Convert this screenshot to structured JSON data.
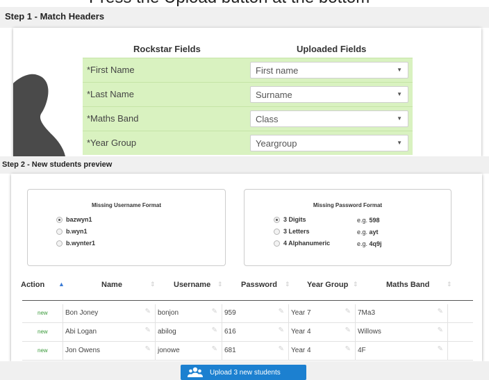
{
  "banner": {
    "text": "Press the Upload button at the bottom"
  },
  "step1": {
    "title": "Step 1 - Match Headers",
    "rockstar_header": "Rockstar Fields",
    "uploaded_header": "Uploaded Fields",
    "rows": [
      {
        "field": "*First Name",
        "value": "First name"
      },
      {
        "field": "*Last Name",
        "value": "Surname"
      },
      {
        "field": "*Maths Band",
        "value": "Class"
      },
      {
        "field": "*Year Group",
        "value": "Yeargroup"
      }
    ],
    "row_color": "#d9f2c0"
  },
  "step2": {
    "title": "Step 2 - New students preview",
    "username_format": {
      "title": "Missing Username Format",
      "options": [
        "bazwyn1",
        "b.wyn1",
        "b.wynter1"
      ],
      "selected": "bazwyn1"
    },
    "password_format": {
      "title": "Missing Password Format",
      "options": [
        {
          "label": "3 Digits",
          "example_prefix": "e.g.",
          "example": "598"
        },
        {
          "label": "3 Letters",
          "example_prefix": "e.g.",
          "example": "ayt"
        },
        {
          "label": "4 Alphanumeric",
          "example_prefix": "e.g.",
          "example": "4q9j"
        }
      ],
      "selected": "3 Digits"
    },
    "table": {
      "columns": [
        "Action",
        "Name",
        "Username",
        "Password",
        "Year Group",
        "Maths Band"
      ],
      "sorted_column": "Action",
      "rows": [
        {
          "action": "new",
          "name": "Bon Joney",
          "username": "bonjon",
          "password": "959",
          "year_group": "Year 7",
          "maths_band": "7Ma3"
        },
        {
          "action": "new",
          "name": "Abi Logan",
          "username": "abilog",
          "password": "616",
          "year_group": "Year 4",
          "maths_band": "Willows"
        },
        {
          "action": "new",
          "name": "Jon Owens",
          "username": "jonowe",
          "password": "681",
          "year_group": "Year 4",
          "maths_band": "4F"
        }
      ]
    }
  },
  "footer": {
    "upload_label": "Upload 3 new students",
    "icon": "users-icon",
    "accent": "#1c80d0"
  }
}
